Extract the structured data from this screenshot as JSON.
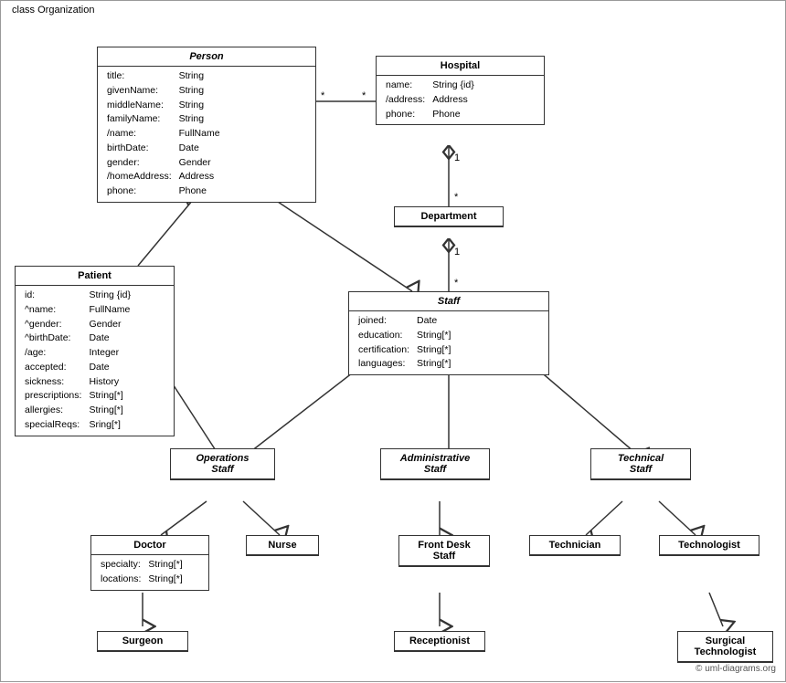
{
  "diagram": {
    "title": "class Organization",
    "classes": {
      "person": {
        "name": "Person",
        "italic": true,
        "attributes": [
          [
            "title:",
            "String"
          ],
          [
            "givenName:",
            "String"
          ],
          [
            "middleName:",
            "String"
          ],
          [
            "familyName:",
            "String"
          ],
          [
            "/name:",
            "FullName"
          ],
          [
            "birthDate:",
            "Date"
          ],
          [
            "gender:",
            "Gender"
          ],
          [
            "/homeAddress:",
            "Address"
          ],
          [
            "phone:",
            "Phone"
          ]
        ]
      },
      "hospital": {
        "name": "Hospital",
        "italic": false,
        "attributes": [
          [
            "name:",
            "String {id}"
          ],
          [
            "/address:",
            "Address"
          ],
          [
            "phone:",
            "Phone"
          ]
        ]
      },
      "department": {
        "name": "Department",
        "italic": false,
        "attributes": []
      },
      "staff": {
        "name": "Staff",
        "italic": true,
        "attributes": [
          [
            "joined:",
            "Date"
          ],
          [
            "education:",
            "String[*]"
          ],
          [
            "certification:",
            "String[*]"
          ],
          [
            "languages:",
            "String[*]"
          ]
        ]
      },
      "patient": {
        "name": "Patient",
        "italic": false,
        "attributes": [
          [
            "id:",
            "String {id}"
          ],
          [
            "^name:",
            "FullName"
          ],
          [
            "^gender:",
            "Gender"
          ],
          [
            "^birthDate:",
            "Date"
          ],
          [
            "/age:",
            "Integer"
          ],
          [
            "accepted:",
            "Date"
          ],
          [
            "sickness:",
            "History"
          ],
          [
            "prescriptions:",
            "String[*]"
          ],
          [
            "allergies:",
            "String[*]"
          ],
          [
            "specialReqs:",
            "Sring[*]"
          ]
        ]
      },
      "operations_staff": {
        "name": "Operations Staff",
        "italic": true,
        "attributes": []
      },
      "administrative_staff": {
        "name": "Administrative Staff",
        "italic": true,
        "attributes": []
      },
      "technical_staff": {
        "name": "Technical Staff",
        "italic": true,
        "attributes": []
      },
      "doctor": {
        "name": "Doctor",
        "italic": false,
        "attributes": [
          [
            "specialty:",
            "String[*]"
          ],
          [
            "locations:",
            "String[*]"
          ]
        ]
      },
      "nurse": {
        "name": "Nurse",
        "italic": false,
        "attributes": []
      },
      "front_desk_staff": {
        "name": "Front Desk Staff",
        "italic": false,
        "attributes": []
      },
      "technician": {
        "name": "Technician",
        "italic": false,
        "attributes": []
      },
      "technologist": {
        "name": "Technologist",
        "italic": false,
        "attributes": []
      },
      "surgeon": {
        "name": "Surgeon",
        "italic": false,
        "attributes": []
      },
      "receptionist": {
        "name": "Receptionist",
        "italic": false,
        "attributes": []
      },
      "surgical_technologist": {
        "name": "Surgical Technologist",
        "italic": false,
        "attributes": []
      }
    },
    "multiplicity": {
      "star": "*",
      "one": "1"
    },
    "copyright": "© uml-diagrams.org"
  }
}
